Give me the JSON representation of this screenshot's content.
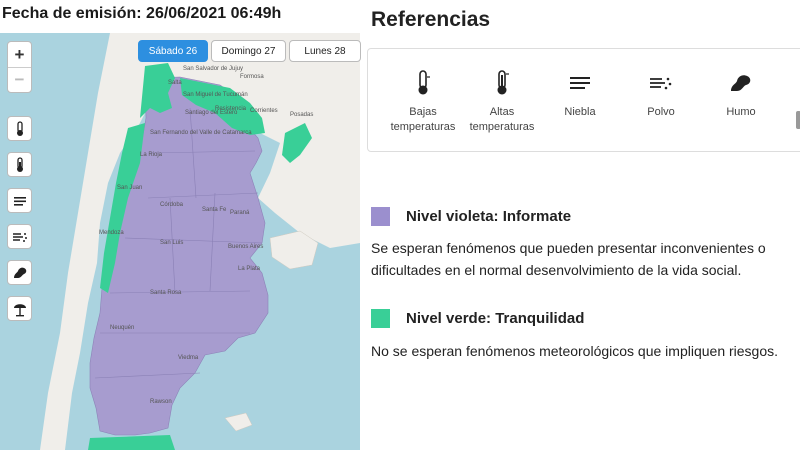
{
  "header": {
    "emission": "Fecha de emisión: 26/06/2021 06:49h"
  },
  "map": {
    "tabs": [
      {
        "label": "Sábado 26",
        "active": true
      },
      {
        "label": "Domingo 27",
        "active": false
      },
      {
        "label": "Lunes 28",
        "active": false
      }
    ],
    "zoom_in": "+",
    "zoom_out": "−",
    "place_labels": [
      "San Salvador de Jujuy",
      "Salta",
      "Formosa",
      "San Miguel de Tucumán",
      "Resistencia",
      "Corrientes",
      "Santiago del Estero",
      "Posadas",
      "San Fernando del Valle de Catamarca",
      "La Rioja",
      "San Juan",
      "Córdoba",
      "Santa Fe",
      "Paraná",
      "Mendoza",
      "San Luis",
      "Buenos Aires",
      "La Plata",
      "Santa Rosa",
      "Neuquén",
      "Viedma",
      "Rawson"
    ],
    "colors": {
      "violet": "#a79ccf",
      "green": "#39cf97",
      "land": "#f0eeea",
      "water": "#aad3df",
      "active_tab": "#2d8fe0"
    }
  },
  "references": {
    "title": "Referencias",
    "items": [
      {
        "icon": "thermometer-low-icon",
        "label_1": "Bajas",
        "label_2": "temperaturas"
      },
      {
        "icon": "thermometer-high-icon",
        "label_1": "Altas",
        "label_2": "temperaturas"
      },
      {
        "icon": "fog-icon",
        "label_1": "Niebla",
        "label_2": ""
      },
      {
        "icon": "dust-icon",
        "label_1": "Polvo",
        "label_2": ""
      },
      {
        "icon": "smoke-icon",
        "label_1": "Humo",
        "label_2": ""
      }
    ]
  },
  "levels": [
    {
      "name": "Nivel violeta: Informate",
      "color": "#9b8fce",
      "description": "Se esperan fenómenos que pueden presentar inconvenientes o dificultades en el normal desenvolvimiento de la vida social."
    },
    {
      "name": "Nivel verde: Tranquilidad",
      "color": "#39cf97",
      "description": "No se esperan fenómenos meteorológicos que impliquen riesgos."
    }
  ]
}
